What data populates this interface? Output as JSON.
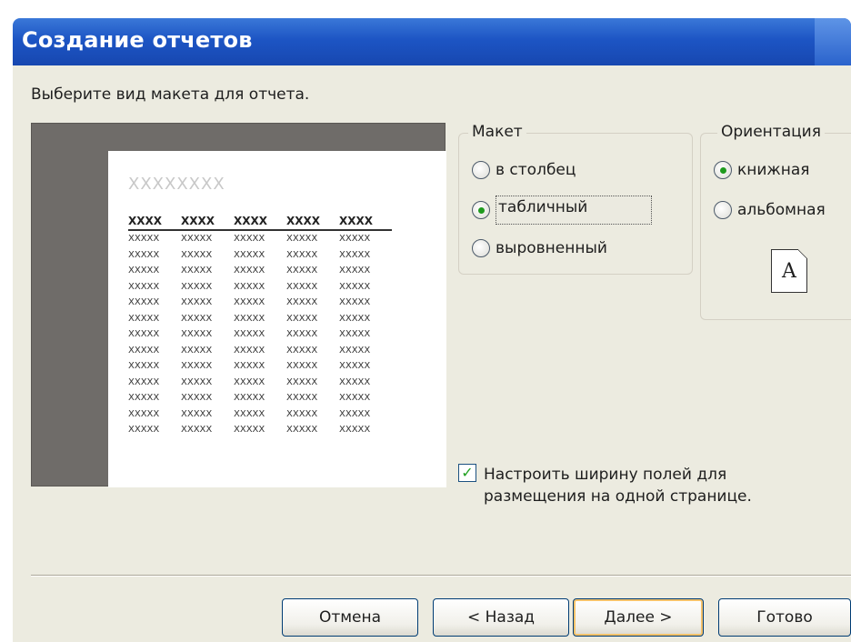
{
  "window": {
    "title": "Создание отчетов"
  },
  "prompt": "Выберите вид макета для отчета.",
  "preview": {
    "title_placeholder": "XXXXXXXX",
    "headers": [
      "XXXX",
      "XXXX",
      "XXXX",
      "XXXX",
      "XXXX"
    ],
    "cell": "XXXXX",
    "row_count": 13
  },
  "layout_group": {
    "legend": "Макет",
    "options": [
      {
        "label": "в столбец",
        "checked": false
      },
      {
        "label": "табличный",
        "checked": true
      },
      {
        "label": "выровненный",
        "checked": false
      }
    ]
  },
  "orientation_group": {
    "legend": "Ориентация",
    "options": [
      {
        "label": "книжная",
        "checked": true
      },
      {
        "label": "альбомная",
        "checked": false
      }
    ],
    "icon_letter": "A"
  },
  "fit_width": {
    "checked": true,
    "label": "Настроить ширину полей для размещения на одной странице."
  },
  "buttons": {
    "cancel": "Отмена",
    "back": "< Назад",
    "next": "Далее >",
    "finish": "Готово"
  }
}
